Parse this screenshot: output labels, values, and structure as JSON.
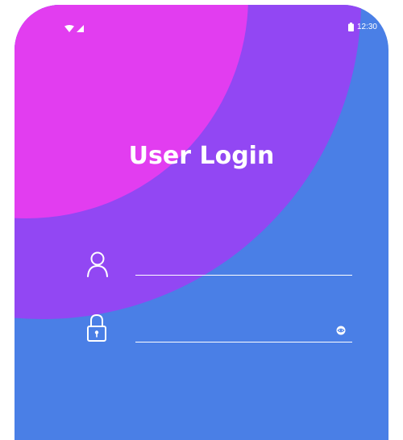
{
  "status_bar": {
    "time": "12:30",
    "icons": [
      "wifi-icon",
      "signal-icon",
      "battery-icon"
    ]
  },
  "login": {
    "title": "User Login",
    "username": {
      "value": "",
      "placeholder": ""
    },
    "password": {
      "value": "",
      "placeholder": ""
    }
  },
  "colors": {
    "background": "#4a7fe6",
    "purple_blob": "#9247f3",
    "pink_blob": "#e23df0",
    "foreground": "#ffffff"
  }
}
